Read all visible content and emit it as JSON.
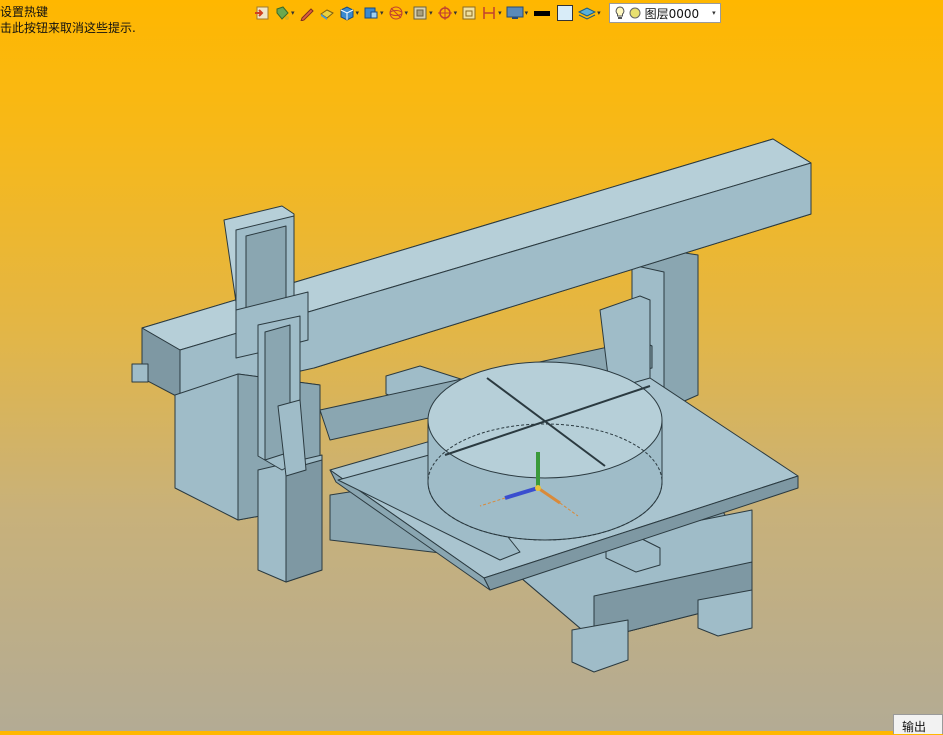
{
  "hint": {
    "line1": "设置热键",
    "line2": "击此按钮来取消这些提示."
  },
  "toolbar": {
    "items": [
      {
        "icon": "import-icon",
        "dropdown": false
      },
      {
        "icon": "paint-bucket-icon",
        "dropdown": true
      },
      {
        "icon": "pencil-icon",
        "dropdown": false
      },
      {
        "icon": "face-color-icon",
        "dropdown": false
      },
      {
        "icon": "solid-box-icon",
        "dropdown": true
      },
      {
        "icon": "render-style-icon",
        "dropdown": true
      },
      {
        "icon": "wireframe-sphere-icon",
        "dropdown": true
      },
      {
        "icon": "view-cube-icon",
        "dropdown": true
      },
      {
        "icon": "snap-target-icon",
        "dropdown": true
      },
      {
        "icon": "frame-icon",
        "dropdown": false
      },
      {
        "icon": "dimension-icon",
        "dropdown": true
      },
      {
        "icon": "display-settings-icon",
        "dropdown": true
      },
      {
        "icon": "line-color-icon",
        "dropdown": false
      },
      {
        "icon": "fill-color-icon",
        "dropdown": false
      },
      {
        "icon": "layer-stack-icon",
        "dropdown": true
      }
    ],
    "layer_select": {
      "value": "图层0000",
      "icons": [
        "bulb-icon",
        "layer-status-icon"
      ]
    }
  },
  "output_tab": "输出",
  "colors": {
    "model_face": "#9fbcc8",
    "model_side": "#7e98a3",
    "model_dark": "#6a8590",
    "model_top": "#b6cfd8",
    "edge": "#2b3a40",
    "gizmo_x": "#d98a3a",
    "gizmo_y": "#3a9a3a",
    "gizmo_z": "#3a4ecf"
  }
}
